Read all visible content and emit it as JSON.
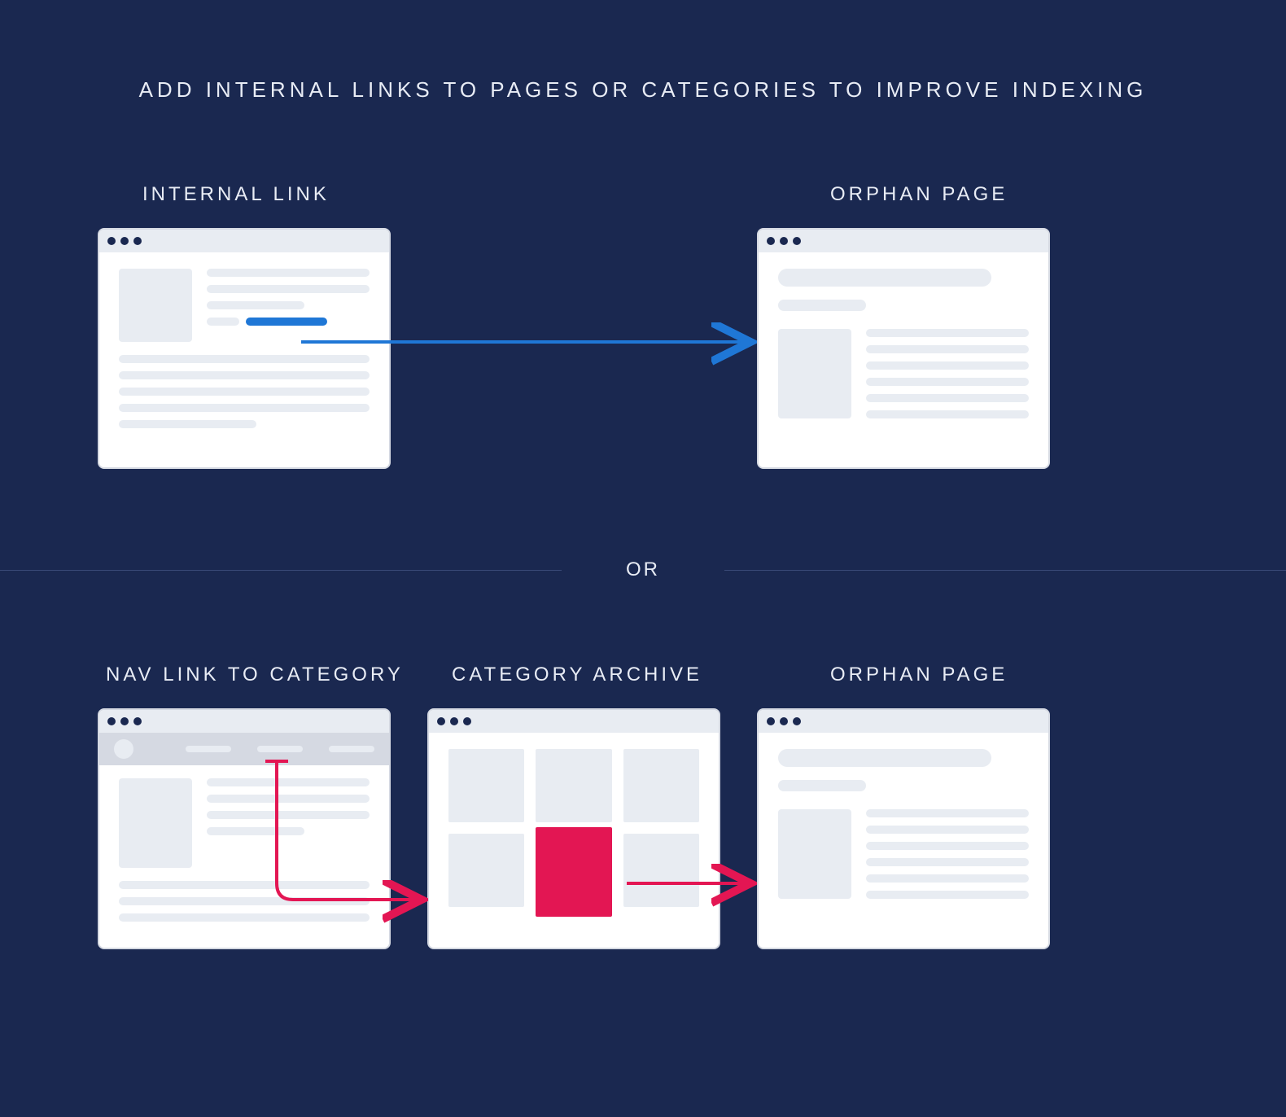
{
  "title": "ADD INTERNAL LINKS TO PAGES OR CATEGORIES TO IMPROVE INDEXING",
  "labels": {
    "internal_link": "INTERNAL LINK",
    "orphan_top": "ORPHAN PAGE",
    "nav_link": "NAV LINK TO CATEGORY",
    "category_archive": "CATEGORY ARCHIVE",
    "orphan_bottom": "ORPHAN PAGE",
    "or": "OR"
  },
  "colors": {
    "background": "#1a2850",
    "blue_arrow": "#1f77d6",
    "red_arrow": "#e31653",
    "wireframe": "#e8ecf2"
  }
}
